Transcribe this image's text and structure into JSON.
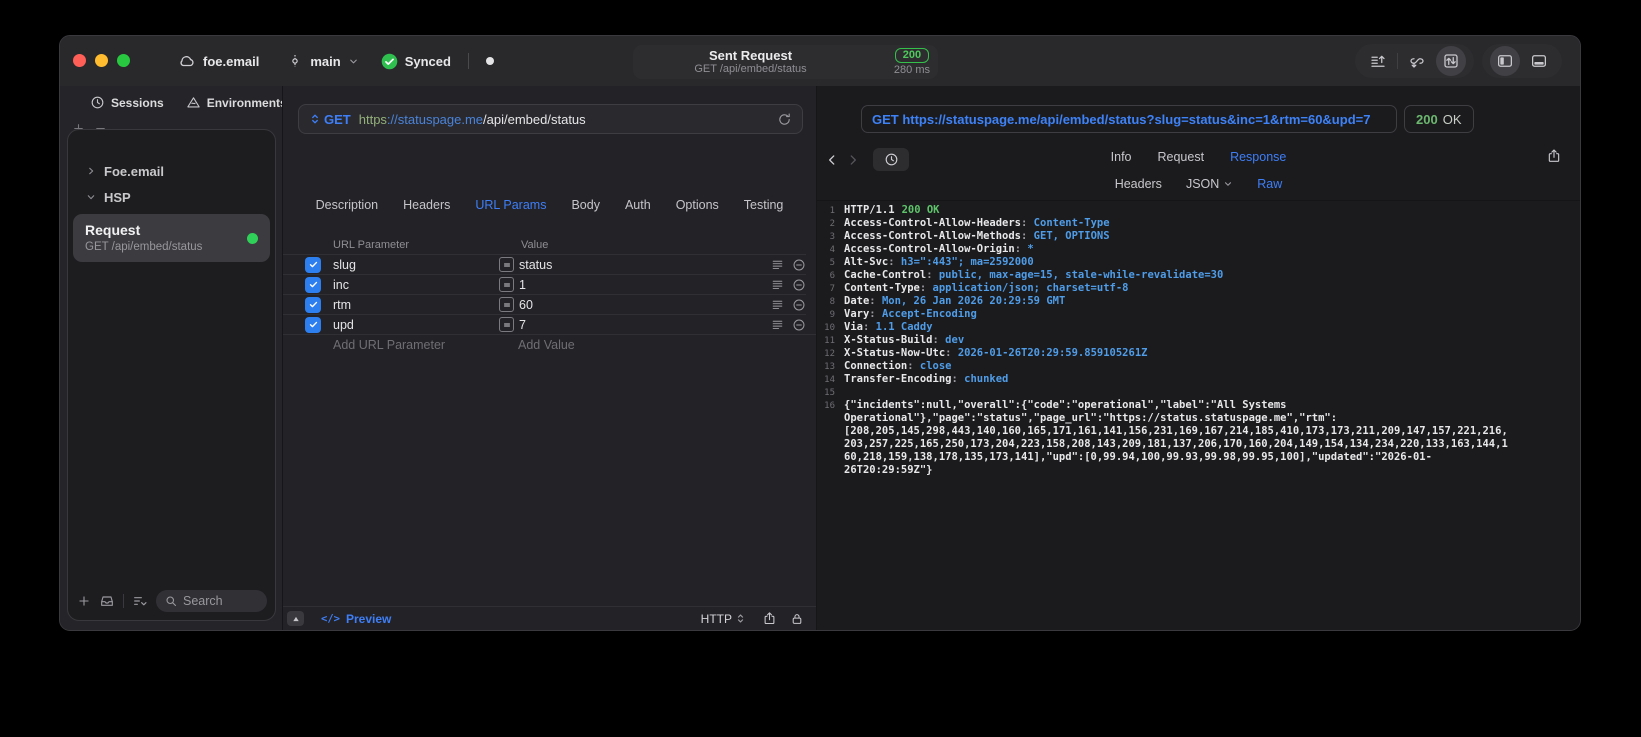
{
  "titlebar": {
    "project": "foe.email",
    "branch": "main",
    "sync_label": "Synced",
    "sent_request": {
      "title": "Sent Request",
      "subtitle": "GET /api/embed/status",
      "status_code": "200",
      "duration": "280 ms"
    }
  },
  "sidebar": {
    "tabs": {
      "sessions": "Sessions",
      "environments": "Environments"
    },
    "tree": {
      "group1": "Foe.email",
      "group2": "HSP"
    },
    "request_item": {
      "title": "Request",
      "subtitle": "GET /api/embed/status"
    },
    "search_placeholder": "Search"
  },
  "request_editor": {
    "method": "GET",
    "url": {
      "scheme": "https",
      "host": "://statuspage.me",
      "path": "/api/embed/status"
    },
    "tabs": {
      "description": "Description",
      "headers": "Headers",
      "url_params": "URL Params",
      "body": "Body",
      "auth": "Auth",
      "options": "Options",
      "testing": "Testing"
    },
    "params": {
      "columns": {
        "name": "URL Parameter",
        "value": "Value"
      },
      "rows": [
        {
          "name": "slug",
          "value": "status"
        },
        {
          "name": "inc",
          "value": "1"
        },
        {
          "name": "rtm",
          "value": "60"
        },
        {
          "name": "upd",
          "value": "7"
        }
      ],
      "add_row": {
        "name": "Add URL Parameter",
        "value": "Add Value"
      }
    },
    "footer": {
      "preview_label": "Preview",
      "code_glyph": "</>",
      "protocol": "HTTP"
    }
  },
  "response_viewer": {
    "request_line": "GET https://statuspage.me/api/embed/status?slug=status&inc=1&rtm=60&upd=7",
    "status_code": "200",
    "status_text": "OK",
    "tabs": {
      "info": "Info",
      "request": "Request",
      "response": "Response"
    },
    "subtabs": {
      "headers": "Headers",
      "json": "JSON",
      "raw": "Raw"
    },
    "code": {
      "status_line": {
        "num": "1",
        "protocol": "HTTP/1.1",
        "status": "200 OK"
      },
      "headers": [
        {
          "num": "2",
          "name": "Access-Control-Allow-Headers",
          "value": "Content-Type"
        },
        {
          "num": "3",
          "name": "Access-Control-Allow-Methods",
          "value": "GET, OPTIONS"
        },
        {
          "num": "4",
          "name": "Access-Control-Allow-Origin",
          "value": "*"
        },
        {
          "num": "5",
          "name": "Alt-Svc",
          "value": "h3=\":443\"; ma=2592000"
        },
        {
          "num": "6",
          "name": "Cache-Control",
          "value": "public, max-age=15, stale-while-revalidate=30"
        },
        {
          "num": "7",
          "name": "Content-Type",
          "value": "application/json; charset=utf-8"
        },
        {
          "num": "8",
          "name": "Date",
          "value": "Mon, 26 Jan 2026 20:29:59 GMT"
        },
        {
          "num": "9",
          "name": "Vary",
          "value": "Accept-Encoding"
        },
        {
          "num": "10",
          "name": "Via",
          "value": "1.1 Caddy"
        },
        {
          "num": "11",
          "name": "X-Status-Build",
          "value": "dev"
        },
        {
          "num": "12",
          "name": "X-Status-Now-Utc",
          "value": "2026-01-26T20:29:59.859105261Z"
        },
        {
          "num": "13",
          "name": "Connection",
          "value": "close"
        },
        {
          "num": "14",
          "name": "Transfer-Encoding",
          "value": "chunked"
        }
      ],
      "blank_num": "15",
      "body_num": "16",
      "body": "{\"incidents\":null,\"overall\":{\"code\":\"operational\",\"label\":\"All Systems Operational\"},\"page\":\"status\",\"page_url\":\"https://status.statuspage.me\",\"rtm\":[208,205,145,298,443,140,160,165,171,161,141,156,231,169,167,214,185,410,173,173,211,209,147,157,221,216,203,257,225,165,250,173,204,223,158,208,143,209,181,137,206,170,160,204,149,154,134,234,220,133,163,144,160,218,159,138,178,135,173,141],\"upd\":[0,99.94,100,99.93,99.98,99.95,100],\"updated\":\"2026-01-26T20:29:59Z\"}"
    }
  },
  "colors": {
    "accent_blue": "#3e7ef7",
    "code_value_blue": "#4f9de8",
    "status_green": "#5ec46a",
    "badge_green": "#35c04b",
    "scheme_green": "#93b07a",
    "selected_row": "#3c3c40",
    "window_bg": "#232327"
  }
}
